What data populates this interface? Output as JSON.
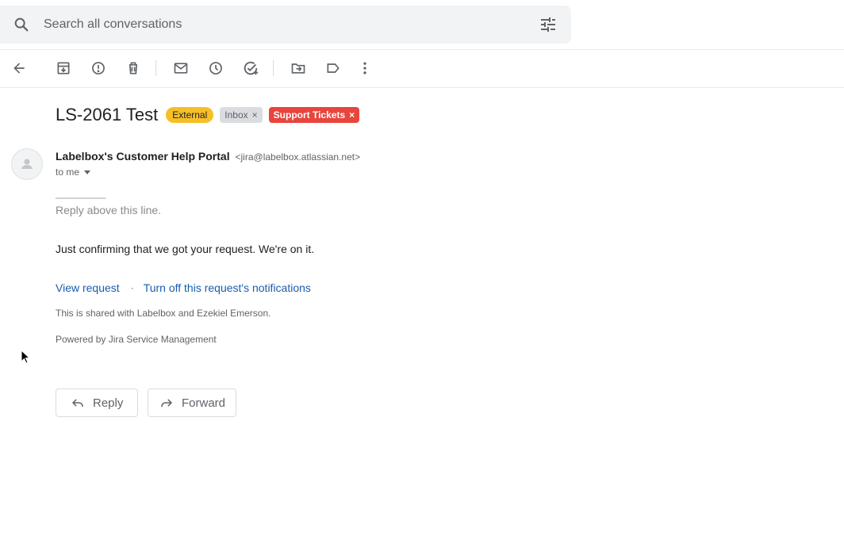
{
  "search": {
    "placeholder": "Search all conversations"
  },
  "toolbar": {
    "icons": [
      "back-arrow-icon",
      "archive-icon",
      "report-spam-icon",
      "delete-icon",
      "mark-unread-icon",
      "snooze-icon",
      "add-to-tasks-icon",
      "move-to-icon",
      "labels-icon",
      "more-vert-icon"
    ]
  },
  "email": {
    "subject": "LS-2061 Test",
    "labels": [
      {
        "text": "External",
        "color": "#f6bf26"
      },
      {
        "text": "Inbox",
        "removable": "×",
        "color": "#dadce0"
      },
      {
        "text": "Support Tickets",
        "removable": "×",
        "color": "#e8453c"
      }
    ],
    "sender_name": "Labelbox's Customer Help Portal",
    "sender_address": "<jira@labelbox.atlassian.net>",
    "to": "to me",
    "separator": "__________",
    "reply_above": "Reply above this line.",
    "message": "Just confirming that we got your request. We're on it.",
    "link_view": "View request",
    "link_dot": "·",
    "link_turn_off": "Turn off this request's notifications",
    "shared_with": "This is shared with Labelbox and Ezekiel Emerson.",
    "powered_by": "Powered by Jira Service Management"
  },
  "actions": {
    "reply": "Reply",
    "forward": "Forward"
  },
  "colors": {
    "link": "#1a5cad",
    "search_bg": "#f1f3f4"
  }
}
